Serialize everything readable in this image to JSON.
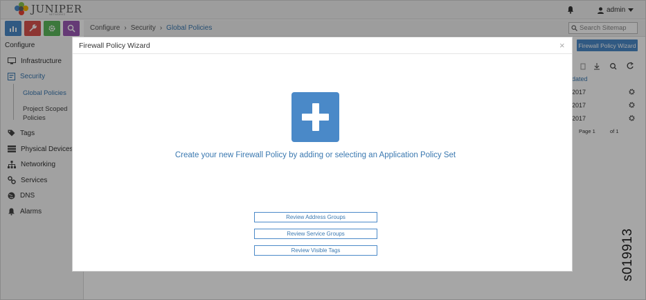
{
  "header": {
    "logo_text": "JUNIPER",
    "logo_sub": "NETWORKS",
    "user": "admin"
  },
  "quick_actions": [
    {
      "name": "monitor",
      "color": "#4a89c8"
    },
    {
      "name": "configure",
      "color": "#d9534f"
    },
    {
      "name": "settings",
      "color": "#5cb85c"
    },
    {
      "name": "query",
      "color": "#9b59b6"
    }
  ],
  "breadcrumb": [
    "Configure",
    "Security",
    "Global Policies"
  ],
  "search": {
    "placeholder": "Search Sitemap"
  },
  "sidebar": {
    "title": "Configure",
    "items": [
      {
        "label": "Infrastructure",
        "icon": "monitor-icon"
      },
      {
        "label": "Security",
        "icon": "security-icon"
      },
      {
        "label": "Tags",
        "icon": "tag-icon"
      },
      {
        "label": "Physical Devices",
        "icon": "server-icon"
      },
      {
        "label": "Networking",
        "icon": "network-icon"
      },
      {
        "label": "Services",
        "icon": "link-icon"
      },
      {
        "label": "DNS",
        "icon": "globe-icon"
      },
      {
        "label": "Alarms",
        "icon": "bell-icon"
      }
    ],
    "security_sub": [
      "Global Policies",
      "Project Scoped",
      "Policies"
    ]
  },
  "background_grid": {
    "wizard_button": "Firewall Policy Wizard",
    "column_header": "dated",
    "rows": [
      "2017",
      "2017",
      "2017"
    ],
    "pager": {
      "page_label": "Page 1",
      "of_label": "of 1"
    }
  },
  "modal": {
    "title": "Firewall Policy Wizard",
    "close": "×",
    "message": "Create your new Firewall Policy by adding or selecting an Application Policy Set",
    "buttons": [
      "Review Address Groups",
      "Review Service Groups",
      "Review Visible Tags"
    ]
  },
  "figure_id": "s019913",
  "colors": {
    "accent": "#4a89c8",
    "link": "#3a78b0"
  }
}
